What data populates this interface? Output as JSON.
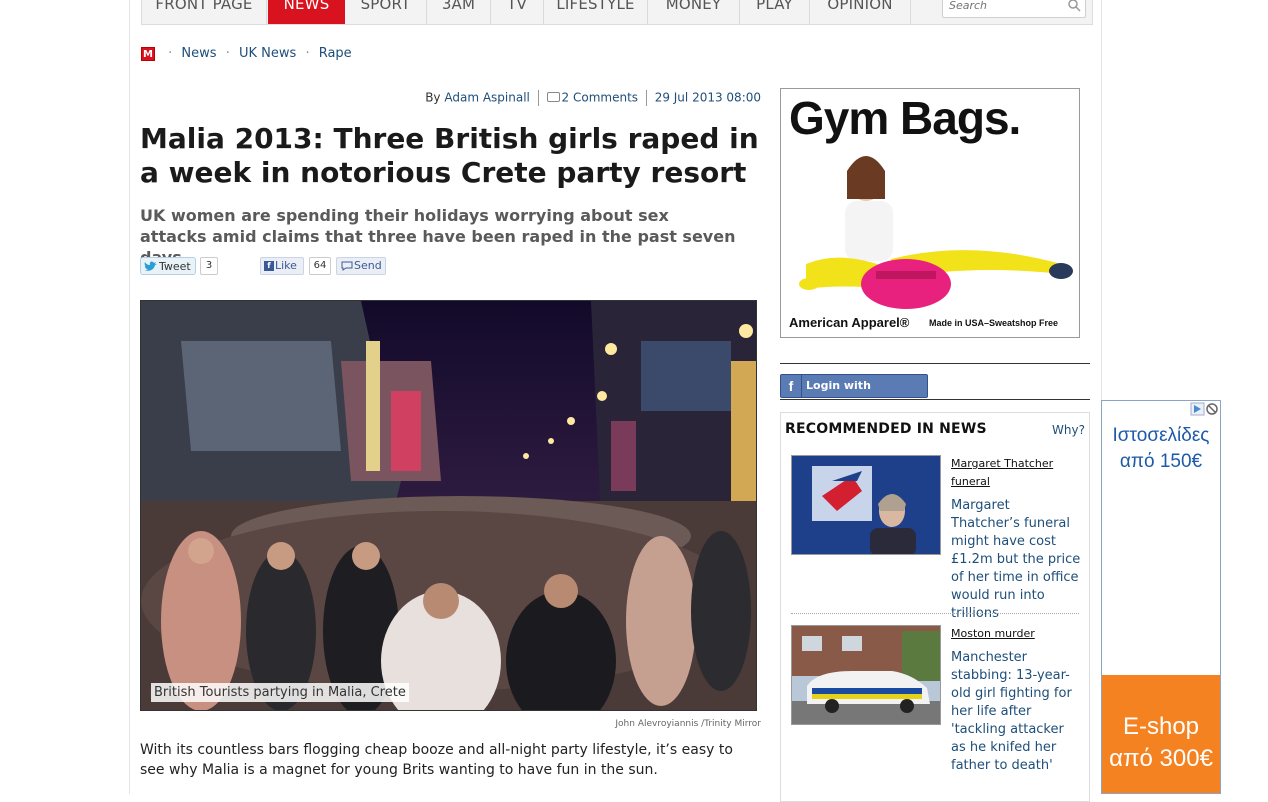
{
  "nav": {
    "items": [
      "FRONT PAGE",
      "NEWS",
      "SPORT",
      "3AM",
      "TV",
      "LIFESTYLE",
      "MONEY",
      "PLAY",
      "OPINION"
    ],
    "active": "NEWS",
    "search_placeholder": "Search"
  },
  "breadcrumb": {
    "logo": "M",
    "items": [
      "News",
      "UK News",
      "Rape"
    ]
  },
  "byline": {
    "prefix": "By",
    "author": "Adam Aspinall",
    "comments": "2 Comments",
    "date": "29 Jul 2013 08:00"
  },
  "article": {
    "headline": "Malia 2013: Three British girls raped in a week in notorious Crete party resort",
    "standfirst": "UK women are spending their holidays worrying about sex attacks amid claims that three have been raped in the past seven days.",
    "photo_caption": "British Tourists partying in Malia, Crete",
    "photo_credit": "John Alevroyiannis /Trinity Mirror",
    "body_1": "With its countless bars flogging cheap booze and all-night party lifestyle, it’s easy to see why Malia is a magnet for young Brits wanting to have fun in the sun."
  },
  "social": {
    "tweet_label": "Tweet",
    "tweet_count": "3",
    "like_label": "Like",
    "like_count": "64",
    "send_label": "Send"
  },
  "ad_main": {
    "headline": "Gym Bags.",
    "brand": "American Apparel®",
    "tagline": "Made in USA–Sweatshop Free"
  },
  "login": {
    "label": "Login with Facebook"
  },
  "recommended": {
    "heading": "RECOMMENDED IN NEWS",
    "why": "Why?",
    "items": [
      {
        "category": "Margaret Thatcher funeral",
        "title": "Margaret Thatcher’s funeral might have cost £1.2m but the price of her time in office would run into trillions"
      },
      {
        "category": "Moston murder",
        "title": "Manchester stabbing: 13-year-old girl fighting for her life after 'tackling attacker as he knifed her father to death'"
      }
    ]
  },
  "side_ad": {
    "line1": "Ιστοσελίδες από 150€",
    "line2": "E-shop από 300€"
  },
  "colors": {
    "brand_red": "#d8121e",
    "link_blue": "#1f4e79",
    "facebook_blue": "#3b5998",
    "ad_orange": "#f58220"
  }
}
